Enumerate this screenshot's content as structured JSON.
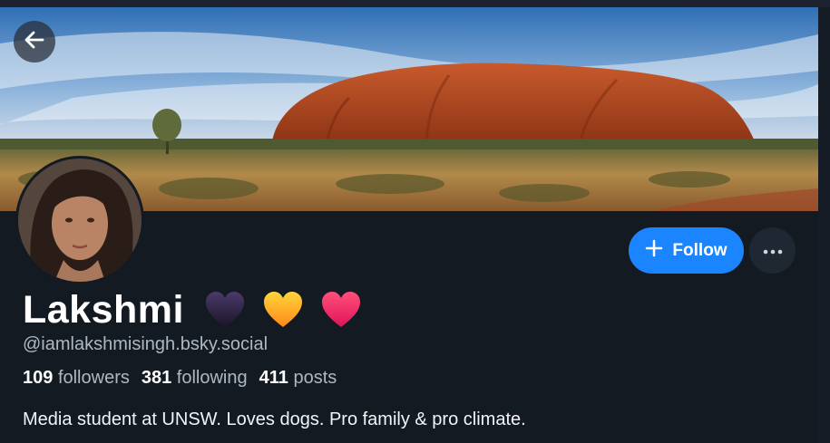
{
  "profile": {
    "display_name": "Lakshmi",
    "name_emojis": [
      "black-heart",
      "yellow-heart",
      "pink-heart"
    ],
    "handle": "@iamlakshmisingh.bsky.social",
    "bio": "Media student at UNSW. Loves dogs. Pro family & pro climate."
  },
  "stats": {
    "followers_count": "109",
    "followers_label": "followers",
    "following_count": "381",
    "following_label": "following",
    "posts_count": "411",
    "posts_label": "posts"
  },
  "actions": {
    "follow_label": "Follow"
  },
  "icons": {
    "back": "arrow-left-icon",
    "follow": "plus-icon",
    "more": "ellipsis-icon"
  },
  "colors": {
    "background": "#141a22",
    "accent": "#1a85ff",
    "secondary_text": "#aeb8c4"
  }
}
